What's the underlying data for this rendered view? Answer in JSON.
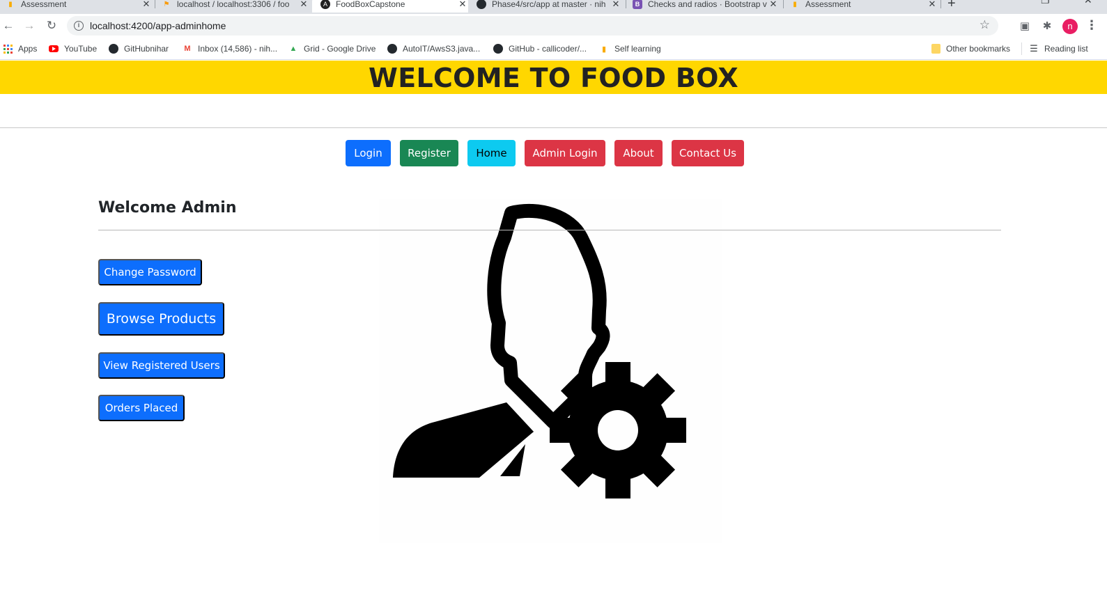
{
  "browser": {
    "tabs": [
      {
        "title": "Assessment",
        "active": false
      },
      {
        "title": "localhost / localhost:3306 / foo",
        "active": false
      },
      {
        "title": "FoodBoxCapstone",
        "active": true
      },
      {
        "title": "Phase4/src/app at master · nih",
        "active": false
      },
      {
        "title": "Checks and radios · Bootstrap v",
        "active": false
      },
      {
        "title": "Assessment",
        "active": false
      }
    ],
    "url": "localhost:4200/app-adminhome",
    "profile_initial": "n",
    "bookmarks": [
      {
        "label": "Apps",
        "icon": "apps-grid-icon"
      },
      {
        "label": "YouTube",
        "icon": "youtube-icon"
      },
      {
        "label": "GitHubnihar",
        "icon": "github-icon"
      },
      {
        "label": "Inbox (14,586) - nih...",
        "icon": "gmail-icon"
      },
      {
        "label": "Grid - Google Drive",
        "icon": "drive-icon"
      },
      {
        "label": "AutoIT/AwsS3.java...",
        "icon": "github-icon"
      },
      {
        "label": "GitHub - callicoder/...",
        "icon": "github-icon"
      },
      {
        "label": "Self learning",
        "icon": "analytics-icon"
      }
    ],
    "other_bookmarks": "Other bookmarks",
    "reading_list": "Reading list"
  },
  "page": {
    "header_title": "WELCOME TO FOOD BOX",
    "nav": {
      "login": "Login",
      "register": "Register",
      "home": "Home",
      "admin_login": "Admin Login",
      "about": "About",
      "contact": "Contact Us"
    },
    "welcome": "Welcome Admin",
    "actions": {
      "change_password": "Change Password",
      "browse_products": "Browse Products",
      "view_users": "View Registered Users",
      "orders_placed": "Orders Placed"
    },
    "illustration_icon": "admin-user-gear-icon",
    "colors": {
      "header_bg": "#ffd700",
      "primary": "#0d6efd",
      "success": "#198754",
      "info": "#0dcaf0",
      "danger": "#dc3545"
    }
  }
}
